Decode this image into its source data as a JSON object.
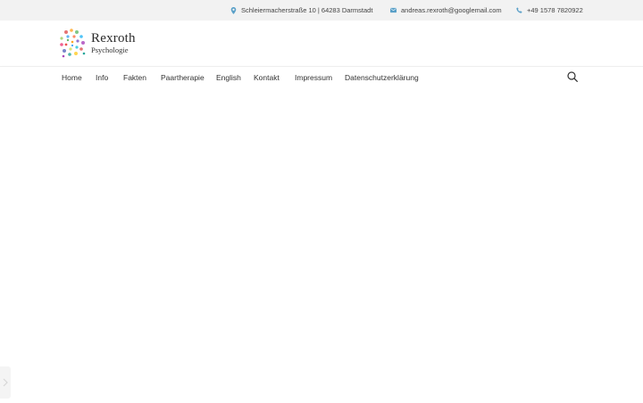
{
  "topbar": {
    "address": "Schleiermacherstraße 10 | 64283 Darmstadt",
    "email": "andreas.rexroth@googlemail.com",
    "phone": "+49 1578 7820922",
    "icons": [
      "map-marker-icon",
      "envelope-icon",
      "phone-icon"
    ],
    "icon_color": "#5aa0c8"
  },
  "logo": {
    "name": "Rexroth",
    "subtitle": "Psychologie"
  },
  "nav": {
    "items": [
      {
        "label": "Home"
      },
      {
        "label": "Info"
      },
      {
        "label": "Fakten"
      },
      {
        "label": "Paartherapie"
      },
      {
        "label": "English"
      },
      {
        "label": "Kontakt"
      },
      {
        "label": "Impressum"
      },
      {
        "label": "Datenschutzerklärung"
      }
    ],
    "search_icon": "search-icon"
  }
}
